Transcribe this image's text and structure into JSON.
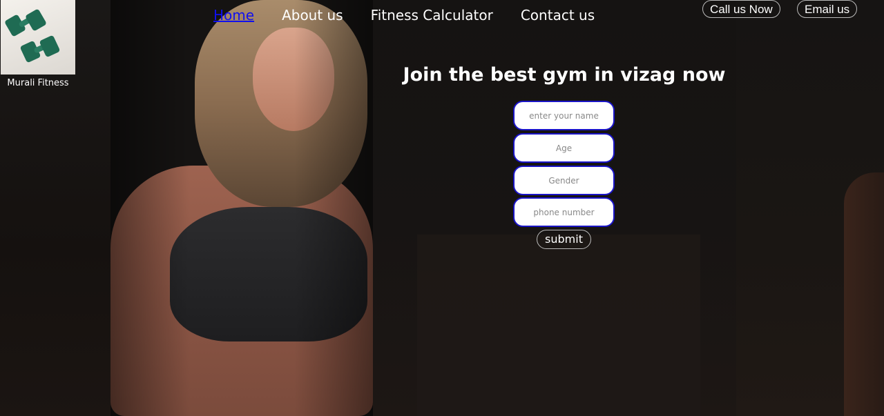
{
  "logo": {
    "caption": "Murali Fitness",
    "icon": "dumbbells-icon"
  },
  "nav": {
    "items": [
      {
        "label": "Home"
      },
      {
        "label": "About us"
      },
      {
        "label": "Fitness Calculator"
      },
      {
        "label": "Contact us"
      }
    ]
  },
  "contact": {
    "call_label": "Call us Now",
    "email_label": "Email us"
  },
  "form": {
    "heading": "Join the best gym in vizag now",
    "name_placeholder": "enter your name",
    "age_placeholder": "Age",
    "gender_placeholder": "Gender",
    "phone_placeholder": "phone number",
    "submit_label": "submit"
  },
  "colors": {
    "active_link": "#1010ee",
    "field_border": "#1a14c8",
    "background": "#151312"
  }
}
